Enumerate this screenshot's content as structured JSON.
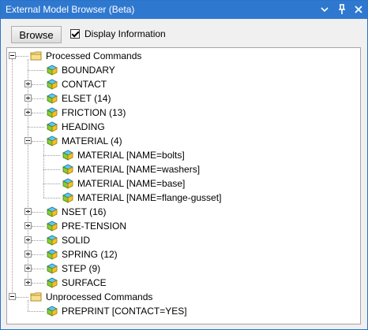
{
  "window": {
    "title": "External Model Browser (Beta)",
    "title_bar_color": "#2f78d0"
  },
  "toolbar": {
    "browse_label": "Browse",
    "display_info_label": "Display Information",
    "display_info_checked": true
  },
  "tree": {
    "processed": {
      "label": "Processed Commands",
      "icon": "folder-icon",
      "expanded": true,
      "items": [
        {
          "label": "BOUNDARY",
          "expandable": false
        },
        {
          "label": "CONTACT",
          "expandable": true
        },
        {
          "label": "ELSET (14)",
          "expandable": true
        },
        {
          "label": "FRICTION (13)",
          "expandable": true
        },
        {
          "label": "HEADING",
          "expandable": false
        },
        {
          "label": "MATERIAL (4)",
          "expandable": true,
          "expanded": true
        },
        {
          "label": "MATERIAL [NAME=bolts]",
          "expandable": false
        },
        {
          "label": "MATERIAL [NAME=washers]",
          "expandable": false
        },
        {
          "label": "MATERIAL [NAME=base]",
          "expandable": false
        },
        {
          "label": "MATERIAL [NAME=flange-gusset]",
          "expandable": false
        },
        {
          "label": "NSET (16)",
          "expandable": true
        },
        {
          "label": "PRE-TENSION",
          "expandable": true
        },
        {
          "label": "SOLID",
          "expandable": true
        },
        {
          "label": "SPRING (12)",
          "expandable": true
        },
        {
          "label": "STEP (9)",
          "expandable": true
        },
        {
          "label": "SURFACE",
          "expandable": true
        }
      ]
    },
    "unprocessed": {
      "label": "Unprocessed Commands",
      "icon": "folder-icon",
      "expanded": true,
      "items": [
        {
          "label": "PREPRINT [CONTACT=YES]",
          "expandable": false
        }
      ]
    }
  }
}
